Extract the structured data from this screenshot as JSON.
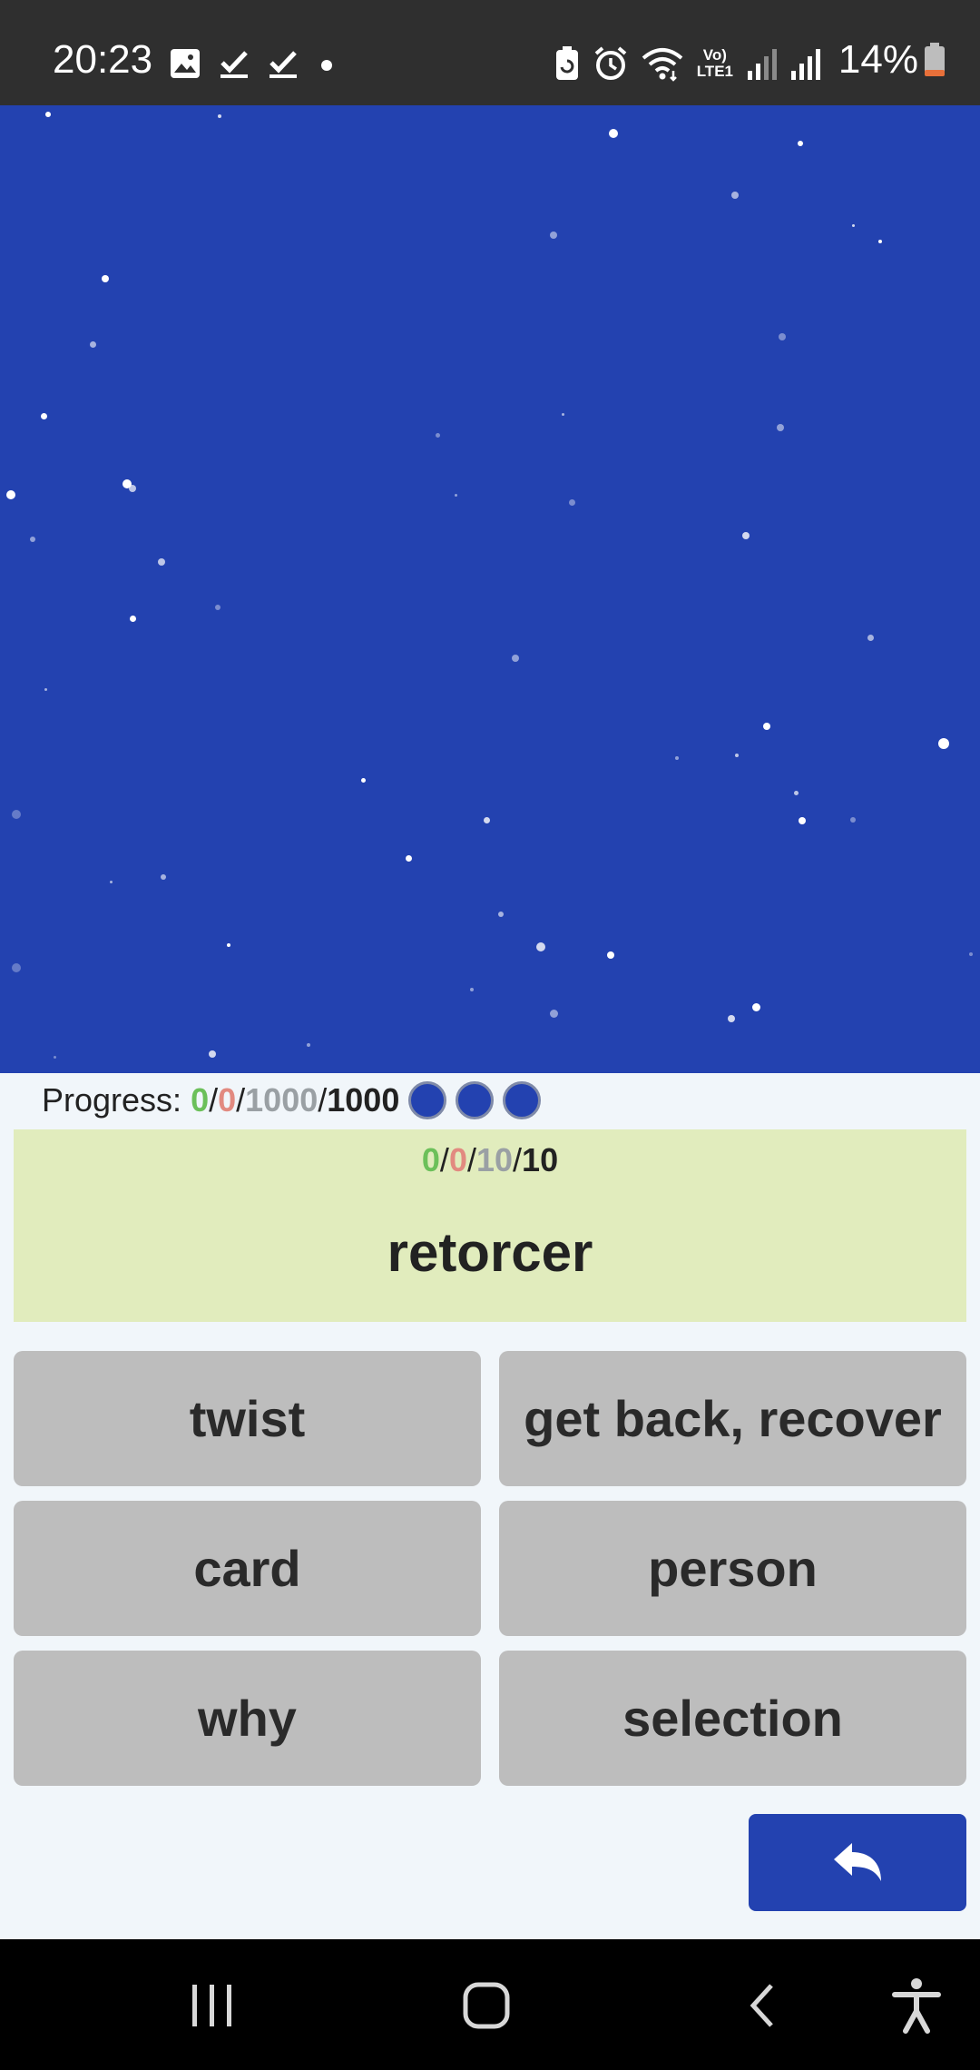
{
  "status_bar": {
    "time": "20:23",
    "battery_percent": "14%",
    "icons_left": [
      "gallery-icon",
      "check-icon",
      "check-icon",
      "dot-icon"
    ],
    "icons_right": [
      "battery-saver-icon",
      "alarm-icon",
      "wifi-icon",
      "volte-icon",
      "signal-icon",
      "signal-icon"
    ],
    "volte_label_top": "Vo)",
    "volte_label_bottom": "LTE1"
  },
  "colors": {
    "accent": "#2342b0",
    "correct": "#6cc05a",
    "wrong": "#e28a80",
    "remaining": "#9aa0a4",
    "card_background": "#e1ecbd",
    "answer_background": "#bdbdbd"
  },
  "progress": {
    "label": "Progress:",
    "correct": "0",
    "wrong": "0",
    "remaining": "1000",
    "total": "1000",
    "lives": 3
  },
  "card": {
    "correct": "0",
    "wrong": "0",
    "remaining": "10",
    "total": "10",
    "word": "retorcer"
  },
  "answers": [
    "twist",
    "get back, recover",
    "card",
    "person",
    "why",
    "selection"
  ],
  "undo_button": {
    "icon": "undo-arrow-icon"
  },
  "nav_bar": {
    "icons": [
      "recent-apps-icon",
      "home-icon",
      "back-icon",
      "accessibility-icon"
    ]
  }
}
